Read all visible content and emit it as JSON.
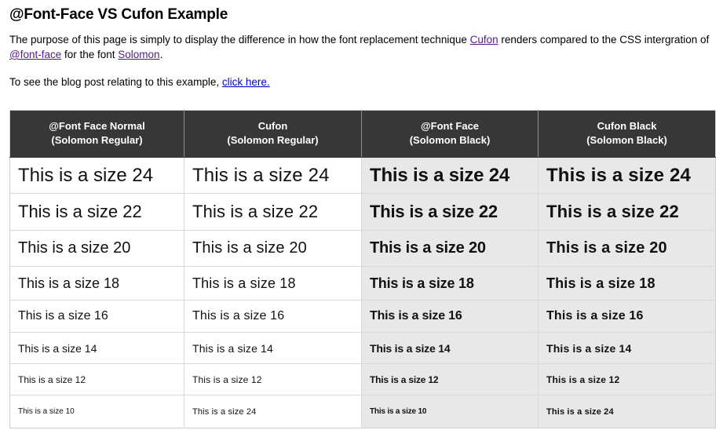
{
  "page": {
    "title": "@Font-Face VS Cufon Example",
    "paragraph1": {
      "seg1": "The purpose of this page is simply to display the difference in how the font replacement technique ",
      "link1": "Cufon",
      "seg2": " renders compared to the CSS intergration of ",
      "link2": "@font-face",
      "seg3": " for the font ",
      "link3": "Solomon",
      "seg4": "."
    },
    "paragraph2": {
      "seg1": "To see the blog post relating to this example, ",
      "link1": "click here.",
      "seg2": ""
    }
  },
  "colors": {
    "header_background": "#373737",
    "header_text": "#ffffff",
    "shaded_cell_background": "#e8e8e8",
    "cell_background": "#ffffff",
    "border": "#d9d9d9",
    "visited_link": "#551a8b",
    "link": "#0000ee",
    "body_text": "#000000"
  },
  "table": {
    "columns": [
      {
        "line1": "@Font Face Normal",
        "line2": "(Solomon Regular)"
      },
      {
        "line1": "Cufon",
        "line2": "(Solomon Regular)"
      },
      {
        "line1": "@Font Face",
        "line2": "(Solomon Black)"
      },
      {
        "line1": "Cufon Black",
        "line2": "(Solomon Black)"
      }
    ],
    "rows": [
      {
        "size": 24,
        "cells": [
          "This is a size 24",
          "This is a size 24",
          "This is a size 24",
          "This is a size 24"
        ]
      },
      {
        "size": 22,
        "cells": [
          "This is a size 22",
          "This is a size 22",
          "This is a size 22",
          "This is a size 22"
        ]
      },
      {
        "size": 20,
        "cells": [
          "This is a size 20",
          "This is a size 20",
          "This is a size 20",
          "This is a size 20"
        ]
      },
      {
        "size": 18,
        "cells": [
          "This is a size 18",
          "This is a size 18",
          "This is a size 18",
          "This is a size 18"
        ]
      },
      {
        "size": 16,
        "cells": [
          "This is a size 16",
          "This is a size 16",
          "This is a size 16",
          "This is a size 16"
        ]
      },
      {
        "size": 14,
        "cells": [
          "This is a size 14",
          "This is a size 14",
          "This is a size 14",
          "This is a size 14"
        ]
      },
      {
        "size": 12,
        "cells": [
          "This is a size 12",
          "This is a size 12",
          "This is a size 12",
          "This is a size 12"
        ]
      },
      {
        "size": 10,
        "cells": [
          "This is a size 10",
          "This is a size 24",
          "This is a size 10",
          "This is a size 24"
        ]
      }
    ]
  }
}
